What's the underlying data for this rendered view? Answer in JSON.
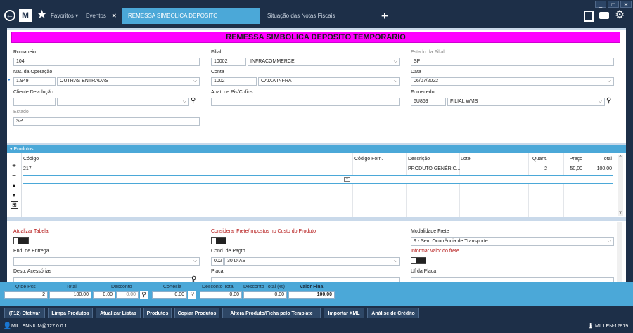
{
  "tabs": {
    "favoritos": "Favoritos",
    "eventos": "Eventos",
    "remessa": "REMESSA SIMBOLICA DEPOSITO TEMPORARIO",
    "situacao": "Situação das Notas Fiscais Eletrônicas",
    "new": "+"
  },
  "colors": {
    "titlebar": "#ff00ff",
    "accent": "#4ba8d8",
    "dark": "#1d2f48"
  },
  "form": {
    "title": "REMESSA SIMBOLICA DEPOSITO TEMPORARIO",
    "romaneio_label": "Romaneio",
    "romaneio": "104",
    "filial_label": "Filial",
    "filial_code": "10002",
    "filial_name": "INFRACOMMERCE",
    "estado_filial_label": "Estado da Filial",
    "estado_filial": "SP",
    "natop_label": "Nat. da Operação",
    "natop_code": "1.949",
    "natop_name": "OUTRAS ENTRADAS",
    "conta_label": "Conta",
    "conta_code": "1002",
    "conta_name": "CAIXA INFRA",
    "data_label": "Data",
    "data": "06/07/2022",
    "cliente_label": "Cliente Devolução",
    "abat_label": "Abat. de Pis/Cofins",
    "fornecedor_label": "Fornecedor",
    "fornecedor_code": "6U869",
    "fornecedor_name": "FILIAL WMS",
    "estado_label": "Estado",
    "estado": "SP"
  },
  "produtos": {
    "header": "Produtos",
    "columns": [
      "Código",
      "Código Forn.",
      "Descrição",
      "Lote",
      "Quant.",
      "Preço",
      "Total"
    ],
    "row": {
      "codigo": "217",
      "codigo_forn": "",
      "descricao": "PRODUTO GENÉRIC...",
      "lote": "",
      "quant": "2",
      "preco": "50,00",
      "total": "100,00"
    }
  },
  "section2": {
    "atualizar": "Atualizar Tabela",
    "considerar": "Considerar Frete/Impostos no Custo do Produto",
    "modalidade_label": "Modalidade Frete",
    "modalidade": "9 - Sem Ocorrência de Transporte",
    "end_label": "End. de Entrega",
    "cond_label": "Cond. de Pagto",
    "cond_code": "002",
    "cond_name": "30 DIAS",
    "informar": "Informar valor do frete",
    "desp_label": "Desp. Acessórias",
    "placa_label": "Placa",
    "uf_label": "Uf da Placa"
  },
  "totals": {
    "qtde_label": "Qtde Pcs",
    "qtde": "2",
    "total_label": "Total",
    "total": "100,00",
    "desconto_label": "Desconto",
    "desc1": "0,00",
    "desc2": "0,00",
    "cortesia_label": "Cortesia",
    "cortesia": "0,00",
    "desc_total_label": "Desconto Total",
    "desc_total": "0,00",
    "desc_pct_label": "Desconto Total (%)",
    "desc_pct": "0,00",
    "valor_final_label": "Valor Final",
    "valor_final": "100,00"
  },
  "actions": [
    "(F12) Efetivar",
    "Limpa Produtos",
    "Atualizar Listas",
    "Produtos",
    "Copiar Produtos",
    "Altera Produto/Ficha pelo Template",
    "Importar XML",
    "Análise de Crédito"
  ],
  "status": {
    "user": "MILLENNIUM@127.0.0.1",
    "server": "MILLEN-12819"
  }
}
